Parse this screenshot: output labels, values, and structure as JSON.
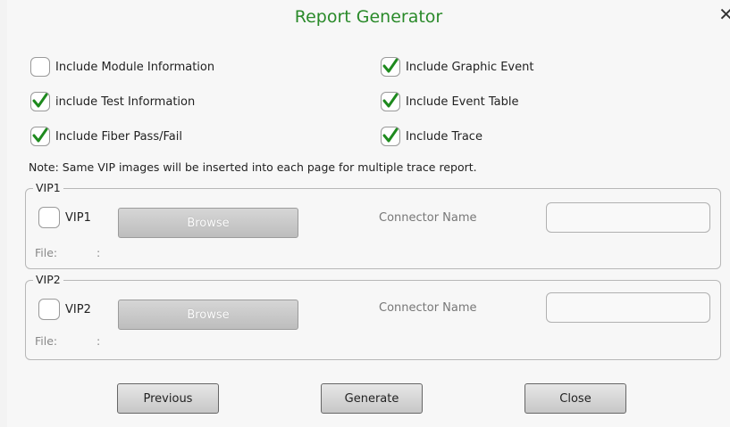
{
  "dialog": {
    "title": "Report Generator",
    "close_glyph": "✕"
  },
  "options": {
    "module_info": {
      "label": "Include Module Information",
      "checked": false
    },
    "test_info": {
      "label": "include Test Information",
      "checked": true
    },
    "fiber_pass_fail": {
      "label": "Include Fiber Pass/Fail",
      "checked": true
    },
    "graphic_event": {
      "label": "Include Graphic Event",
      "checked": true
    },
    "event_table": {
      "label": "Include Event Table",
      "checked": true
    },
    "trace": {
      "label": "Include Trace",
      "checked": true
    }
  },
  "note": "Note: Same VIP images will be inserted into each page for multiple trace report.",
  "vip1": {
    "group_label": "VIP1",
    "check_label": "VIP1",
    "checked": false,
    "browse_label": "Browse",
    "connector_label": "Connector Name",
    "connector_value": "",
    "file_label": "File:",
    "file_sep": ":"
  },
  "vip2": {
    "group_label": "VIP2",
    "check_label": "VIP2",
    "checked": false,
    "browse_label": "Browse",
    "connector_label": "Connector Name",
    "connector_value": "",
    "file_label": "File:",
    "file_sep": ":"
  },
  "buttons": {
    "previous": "Previous",
    "generate": "Generate",
    "close": "Close"
  },
  "colors": {
    "title": "#2a8a2a",
    "checkmark": "#1e8a1e"
  }
}
